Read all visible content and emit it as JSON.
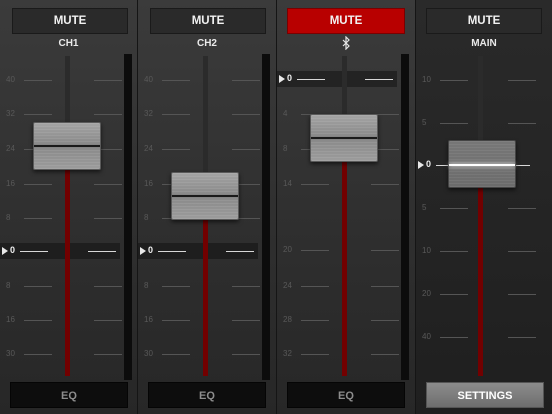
{
  "channels": [
    {
      "id": "ch1",
      "mute_label": "MUTE",
      "muted": false,
      "name": "CH1",
      "bluetooth": false,
      "scale": [
        "40",
        "32",
        "24",
        "16",
        "8",
        "0",
        "8",
        "16",
        "30"
      ],
      "bottom_label": "EQ"
    },
    {
      "id": "ch2",
      "mute_label": "MUTE",
      "muted": false,
      "name": "CH2",
      "bluetooth": false,
      "scale": [
        "40",
        "32",
        "24",
        "16",
        "8",
        "0",
        "8",
        "16",
        "30"
      ],
      "bottom_label": "EQ"
    },
    {
      "id": "bt",
      "mute_label": "MUTE",
      "muted": true,
      "name": "",
      "bluetooth": true,
      "scale": [
        "0",
        "4",
        "8",
        "14",
        "20",
        "24",
        "28",
        "32"
      ],
      "bottom_label": "EQ"
    },
    {
      "id": "main",
      "mute_label": "MUTE",
      "muted": false,
      "name": "MAIN",
      "bluetooth": false,
      "scale": [
        "10",
        "5",
        "0",
        "5",
        "10",
        "20",
        "40"
      ],
      "bottom_label": "SETTINGS"
    }
  ],
  "colors": {
    "mute_active": "#b80000",
    "level": "#720000"
  },
  "icons": {
    "bluetooth": "bluetooth-icon",
    "zero_marker": "zero-marker-arrow"
  }
}
